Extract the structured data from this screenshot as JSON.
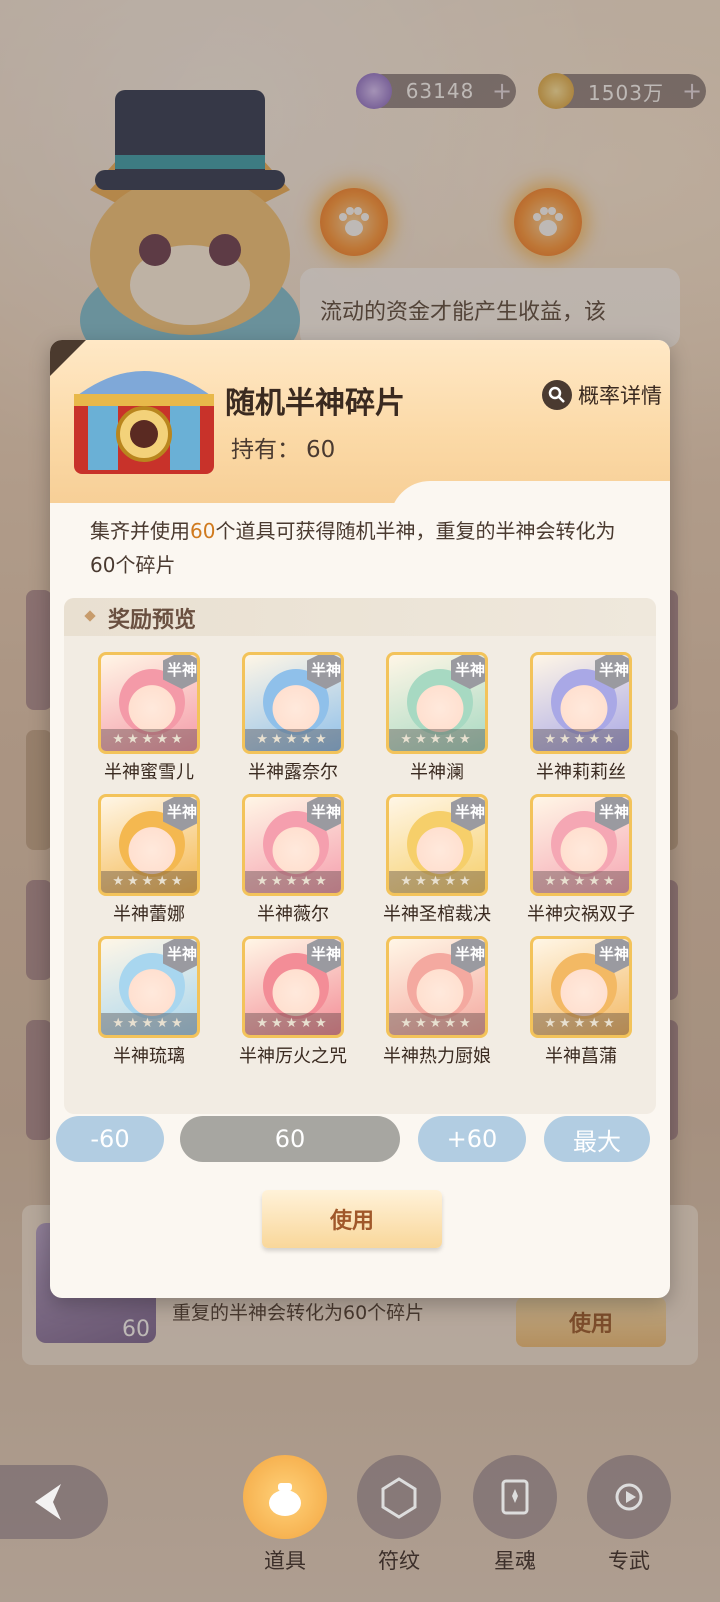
{
  "currencies": [
    {
      "value": "63148",
      "plus": "+"
    },
    {
      "value": "1503万",
      "plus": "+"
    }
  ],
  "background": {
    "speech": "流动的资金才能产生收益，该",
    "item_desc": "集齐并使用60个道具可获得随机半神，重复的半神会转化为60个碎片",
    "item_count": "60",
    "use_label": "使用"
  },
  "modal": {
    "title": "随机半神碎片",
    "owned_label": "持有：",
    "owned_value": "60",
    "prob_label": "概率详情",
    "desc_pre": "集齐并使用",
    "desc_num": "60",
    "desc_post": "个道具可获得随机半神，重复的半神会转化为60个碎片",
    "rewards_title": "奖励预览",
    "badge": "半神",
    "stars": "★★★★★",
    "rewards": [
      {
        "name": "半神蜜雪儿",
        "color": "#f49aa8"
      },
      {
        "name": "半神露奈尔",
        "color": "#8fc0ea"
      },
      {
        "name": "半神澜",
        "color": "#a7d9c2"
      },
      {
        "name": "半神莉莉丝",
        "color": "#a9a8e6"
      },
      {
        "name": "半神蕾娜",
        "color": "#f4b850"
      },
      {
        "name": "半神薇尔",
        "color": "#f59fae"
      },
      {
        "name": "半神圣棺裁决",
        "color": "#f6cf6a"
      },
      {
        "name": "半神灾祸双子",
        "color": "#f5a7b4"
      },
      {
        "name": "半神琉璃",
        "color": "#a8d6ef"
      },
      {
        "name": "半神厉火之咒",
        "color": "#f38d97"
      },
      {
        "name": "半神热力厨娘",
        "color": "#f4a9a0"
      },
      {
        "name": "半神菖蒲",
        "color": "#f3b964"
      }
    ],
    "minus_label": "-60",
    "qty_value": "60",
    "plus_label": "+60",
    "max_label": "最大",
    "use_label": "使用"
  },
  "nav": [
    {
      "label": "道具",
      "active": true
    },
    {
      "label": "符纹",
      "active": false
    },
    {
      "label": "星魂",
      "active": false
    },
    {
      "label": "专武",
      "active": false
    }
  ]
}
